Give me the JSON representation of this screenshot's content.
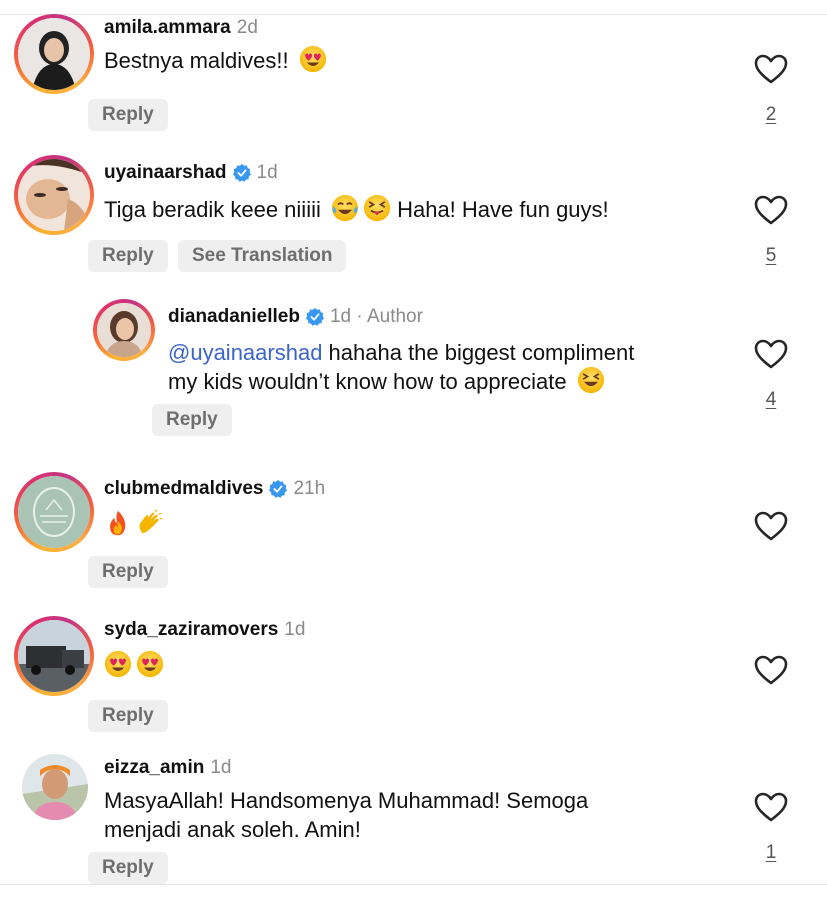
{
  "comments": [
    {
      "username": "amila.ammara",
      "meta": "2d",
      "text": "Bestnya maldives!! ",
      "emoji": [
        "heart-eyes"
      ],
      "reply_label": "Reply",
      "likes": "2"
    },
    {
      "username": "uyainaarshad",
      "verified": true,
      "meta": "1d",
      "text_before": "Tiga beradik keee niiiii ",
      "emoji": [
        "tears-of-joy",
        "squint-tongue"
      ],
      "text_after": " Haha! Have fun guys!",
      "reply_label": "Reply",
      "translate_label": "See Translation",
      "likes": "5"
    },
    {
      "username": "dianadanielleb",
      "verified": true,
      "meta": "1d · Author",
      "mention": "@uyainaarshad",
      "text_line1": " hahaha the biggest compliment",
      "text_line2": "my kids wouldn’t know how to appreciate ",
      "emoji": [
        "laughing"
      ],
      "reply_label": "Reply",
      "likes": "4"
    },
    {
      "username": "clubmedmaldives",
      "verified": true,
      "meta": "21h",
      "emoji": [
        "fire",
        "clapping-hands"
      ],
      "reply_label": "Reply",
      "likes": ""
    },
    {
      "username": "syda_zaziramovers",
      "meta": "1d",
      "emoji": [
        "heart-eyes",
        "heart-eyes"
      ],
      "reply_label": "Reply",
      "likes": ""
    },
    {
      "username": "eizza_amin",
      "meta": "1d",
      "text_line1": "MasyaAllah! Handsomenya Muhammad! Semoga",
      "text_line2": "menjadi anak soleh. Amin!",
      "reply_label": "Reply",
      "likes": "1"
    }
  ],
  "colors": {
    "verified": "#3897f0",
    "mention": "#3a65c8",
    "meta": "#8a8a8a",
    "pill_bg": "#efefef"
  }
}
